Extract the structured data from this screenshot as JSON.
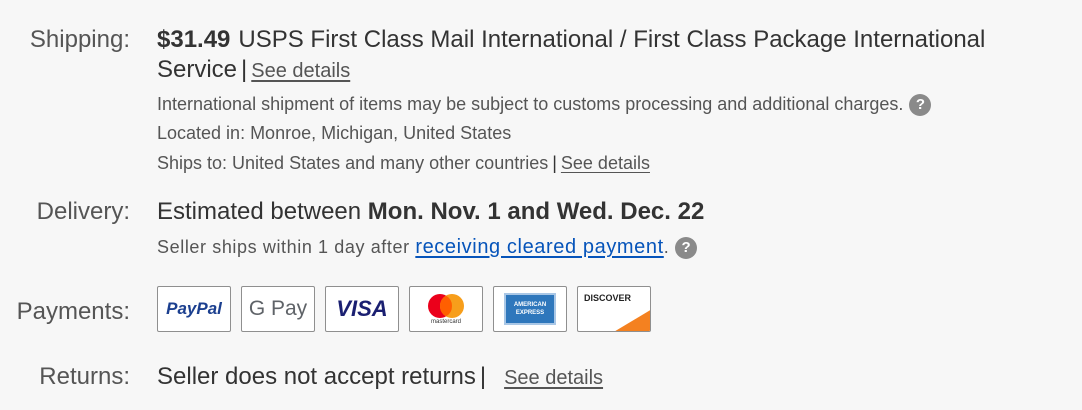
{
  "shipping": {
    "label": "Shipping:",
    "price": "$31.49",
    "method_line1": "USPS First Class Mail International / First Class Package International",
    "method_line2": "Service",
    "see_details": "See details",
    "customs_note": "International shipment of items may be subject to customs processing and additional charges.",
    "location": "Located in:  Monroe, Michigan, United States",
    "ships_to": "Ships to:  United States and many other countries",
    "ships_to_details": "See details"
  },
  "delivery": {
    "label": "Delivery:",
    "prefix": "Estimated between ",
    "range": "Mon. Nov. 1 and Wed. Dec. 22",
    "handling_prefix": "Seller ships within 1 day after ",
    "handling_link": "receiving cleared payment",
    "handling_suffix": "."
  },
  "payments": {
    "label": "Payments:",
    "methods": [
      {
        "name": "PayPal",
        "icon": "paypal-logo"
      },
      {
        "name": "G Pay",
        "icon": "google-pay-logo"
      },
      {
        "name": "VISA",
        "icon": "visa-logo"
      },
      {
        "name": "mastercard",
        "icon": "mastercard-logo"
      },
      {
        "name": "AMERICAN EXPRESS",
        "icon": "amex-logo"
      },
      {
        "name": "DISCOVER",
        "icon": "discover-logo"
      }
    ]
  },
  "returns": {
    "label": "Returns:",
    "text": "Seller does not accept returns",
    "see_details": "See details"
  },
  "colors": {
    "link_blue": "#0654ba",
    "help_icon": "#8a8a8a",
    "background": "#f7f7f7"
  }
}
